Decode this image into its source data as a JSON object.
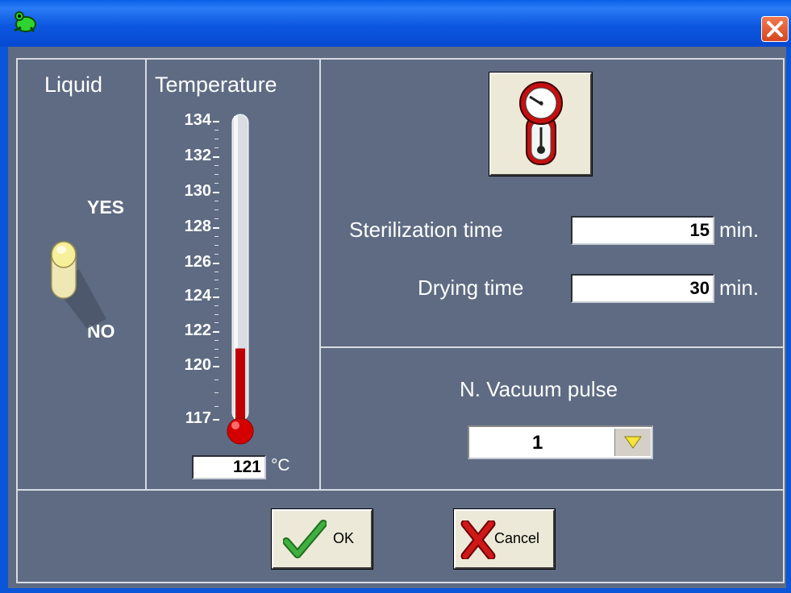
{
  "window": {
    "title": "",
    "icon": "green-frog-app-icon",
    "close_icon": "close-icon"
  },
  "liquid": {
    "header": "Liquid",
    "yes_label": "YES",
    "no_label": "NO",
    "toggle_state": "YES"
  },
  "temperature": {
    "header": "Temperature",
    "ticks": [
      "134",
      "132",
      "130",
      "128",
      "126",
      "124",
      "122",
      "120",
      "117"
    ],
    "value": "121",
    "unit": "°C",
    "fill_level": 121
  },
  "times": {
    "gauge_icon": "pressure-gauge-icon",
    "sterilization_label": "Sterilization time",
    "sterilization_value": "15",
    "sterilization_unit": "min.",
    "drying_label": "Drying time",
    "drying_value": "30",
    "drying_unit": "min."
  },
  "vacuum": {
    "label": "N. Vacuum pulse",
    "selected": "1",
    "dropdown_icon": "chevron-down-icon"
  },
  "buttons": {
    "ok_label": "OK",
    "cancel_label": "Cancel"
  },
  "colors": {
    "panel": "#5e6b82",
    "mercury": "#c00000",
    "ok_check": "#2e8b2e",
    "cancel_x": "#c41010"
  }
}
